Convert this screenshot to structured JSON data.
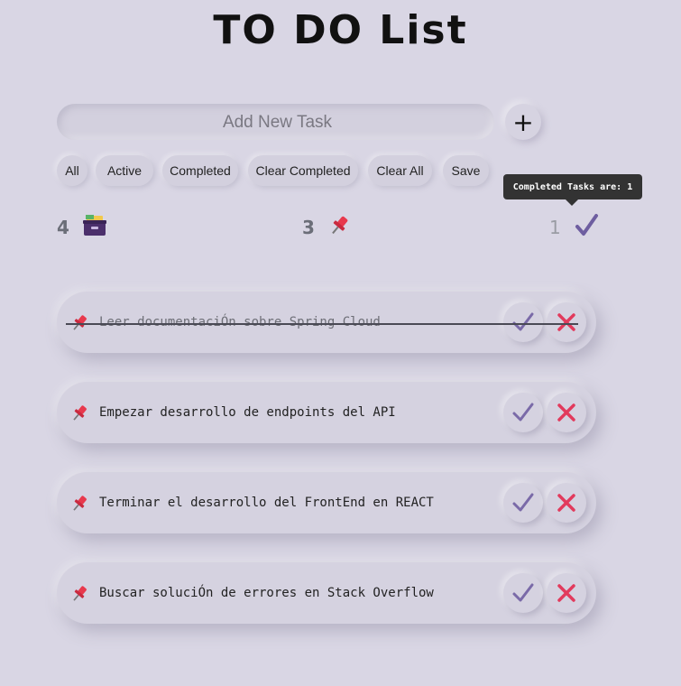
{
  "title": "TO DO List",
  "add": {
    "placeholder": "Add New Task",
    "button_label": "+"
  },
  "filters": [
    "All",
    "Active",
    "Completed",
    "Clear Completed",
    "Clear All",
    "Save"
  ],
  "tooltip": "Completed Tasks are: 1",
  "stats": {
    "total": "4",
    "active": "3",
    "completed": "1"
  },
  "tasks": [
    {
      "text": "Leer documentaciÓn sobre Spring Cloud",
      "completed": true
    },
    {
      "text": "Empezar desarrollo de endpoints del API",
      "completed": false
    },
    {
      "text": "Terminar el desarrollo del FrontEnd en REACT",
      "completed": false
    },
    {
      "text": "Buscar soluciÓn de errores en Stack Overflow",
      "completed": false
    }
  ],
  "colors": {
    "check": "#7a6aa8",
    "delete": "#e23a5c",
    "pin": "#e8394d"
  },
  "icons": {
    "total": "archive-box-icon",
    "active": "pushpin-icon",
    "completed": "checkmark-icon"
  }
}
